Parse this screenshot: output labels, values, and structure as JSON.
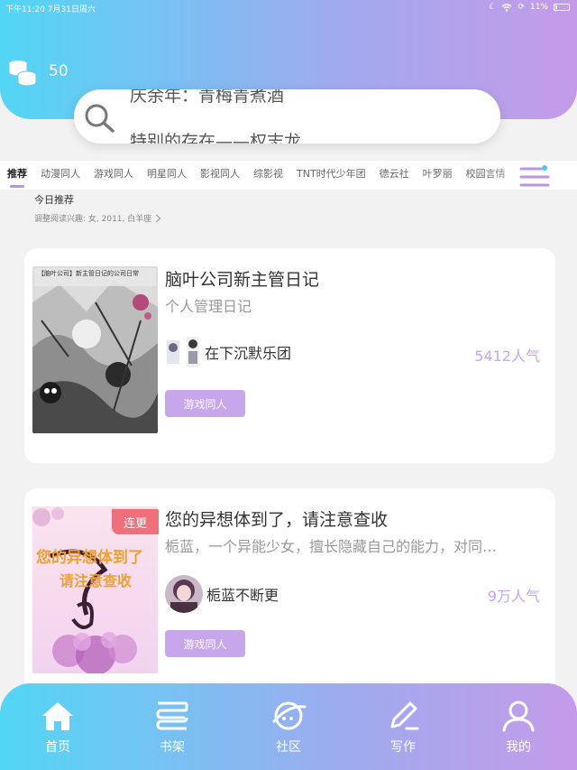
{
  "status_bar": {
    "time_date": "下午11:20  7月31日周六",
    "battery": "11%"
  },
  "coins": {
    "count": "50"
  },
  "search": {
    "lines": [
      "庆余年：青梅青煮酒",
      "特别的存在——权志龙"
    ]
  },
  "tabs": [
    "推荐",
    "动漫同人",
    "游戏同人",
    "明星同人",
    "影视同人",
    "综影视",
    "TNT时代少年团",
    "德云社",
    "叶罗丽",
    "校园言情"
  ],
  "section": {
    "title": "今日推荐",
    "interest": "调整阅读兴趣: 女, 2011, 白羊座"
  },
  "books": [
    {
      "title": "脑叶公司新主管日记",
      "subtitle": "个人管理日记",
      "author": "在下沉默乐团",
      "popularity": "5412人气",
      "tag": "游戏同人",
      "badge": "",
      "cover_text": "【脑叶公司】新主管日记的公司日常"
    },
    {
      "title": "您的异想体到了，请注意查收",
      "subtitle": "栀蓝，一个异能少女，擅长隐藏自己的能力，对同…",
      "author": "栀蓝不断更",
      "popularity": "9万人气",
      "tag": "游戏同人",
      "badge": "连更",
      "cover_text": "您的异想体到了请注意查收"
    }
  ],
  "bottom_nav": [
    {
      "label": "首页",
      "icon": "home-icon"
    },
    {
      "label": "书架",
      "icon": "bookshelf-icon"
    },
    {
      "label": "社区",
      "icon": "planet-icon"
    },
    {
      "label": "写作",
      "icon": "pen-icon"
    },
    {
      "label": "我的",
      "icon": "user-icon"
    }
  ],
  "colors": {
    "gradient_start": "#52d6f4",
    "gradient_end": "#c49be8",
    "accent": "#c7a6ec",
    "badge": "#ef6f7a"
  }
}
